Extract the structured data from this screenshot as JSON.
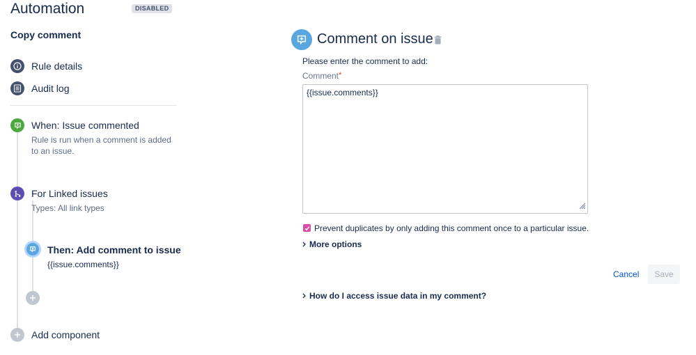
{
  "header": {
    "title": "Automation",
    "status_badge": "DISABLED",
    "rule_name": "Copy comment"
  },
  "sidebar": {
    "nav": [
      {
        "label": "Rule details",
        "icon": "info-icon"
      },
      {
        "label": "Audit log",
        "icon": "list-icon"
      }
    ],
    "trigger": {
      "title": "When: Issue commented",
      "desc_line1": "Rule is run when a comment is added",
      "desc_line2": "to an issue.",
      "icon": "comment-trigger-icon",
      "color": "#4fa83d"
    },
    "branch": {
      "title": "For Linked issues",
      "desc": "Types: All link types",
      "icon": "branch-icon",
      "color": "#5e4db2"
    },
    "action": {
      "title": "Then: Add comment to issue",
      "desc": "{{issue.comments}}",
      "icon": "comment-action-icon",
      "color": "#5aa6e0"
    },
    "add_component_label": "Add component"
  },
  "panel": {
    "title": "Comment on issue",
    "instruction": "Please enter the comment to add:",
    "comment_label": "Comment",
    "required_mark": "*",
    "comment_value": "{{issue.comments}}",
    "prevent_duplicates_label": "Prevent duplicates by only adding this comment once to a particular issue.",
    "prevent_duplicates_checked": true,
    "more_options_label": "More options",
    "cancel_label": "Cancel",
    "save_label": "Save",
    "help_link_label": "How do I access issue data in my comment?"
  },
  "colors": {
    "accent_blue": "#0052cc",
    "checkbox": "#d94ea8"
  }
}
